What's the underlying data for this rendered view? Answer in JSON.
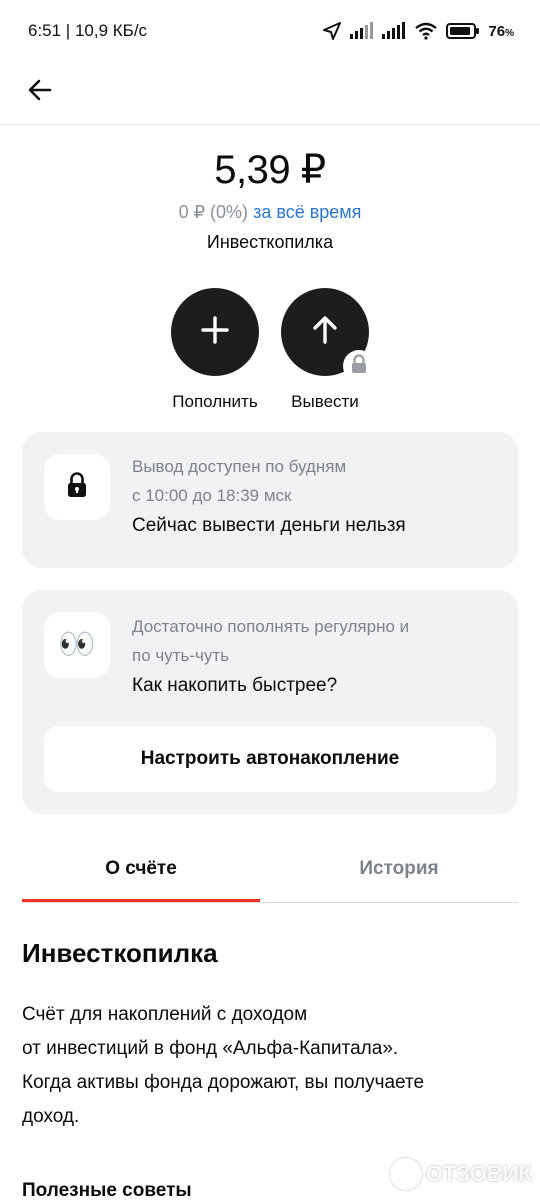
{
  "status_bar": {
    "time_speed": "6:51 | 10,9 КБ/с",
    "battery_percent": "76",
    "battery_suffix": "%",
    "icons": [
      "location-arrow-icon",
      "signal-icon",
      "signal-icon",
      "wifi-icon",
      "battery-icon"
    ]
  },
  "header": {
    "back_icon": "arrow-left-icon"
  },
  "balance": {
    "integer": "5",
    "decimal": ",39 ₽",
    "change_value": "0 ₽ (0%)",
    "change_period": "за всё время",
    "account_name": "Инвесткопилка"
  },
  "actions": [
    {
      "label": "Пополнить",
      "icon": "plus-icon"
    },
    {
      "label": "Вывести",
      "icon": "arrow-up-icon",
      "badge_icon": "lock-icon"
    }
  ],
  "withdraw_card": {
    "icon": "lock-icon",
    "line1": "Вывод доступен по будням",
    "line2": "с 10:00 до 18:39 мск",
    "main": "Сейчас вывести деньги нельзя"
  },
  "savings_card": {
    "icon": "eyes-icon",
    "emoji": "👀",
    "line1": "Достаточно пополнять регулярно и",
    "line2": "по чуть-чуть",
    "main": "Как накопить быстрее?",
    "button_label": "Настроить автонакопление"
  },
  "tabs": [
    {
      "label": "О счёте",
      "active": true
    },
    {
      "label": "История",
      "active": false
    }
  ],
  "about": {
    "title": "Инвесткопилка",
    "lines": [
      "Счёт для накоплений с доходом",
      "от инвестиций в фонд «Альфа-Капитала».",
      "Когда активы фонда дорожают, вы получаете",
      "доход."
    ],
    "tips_title": "Полезные советы"
  },
  "watermark": {
    "text": "ОТЗОВИК"
  },
  "colors": {
    "accent_red": "#ef3124",
    "link_blue": "#2a78c8",
    "card_bg": "#f1f2f4",
    "dark_button": "#1d1d1f"
  }
}
